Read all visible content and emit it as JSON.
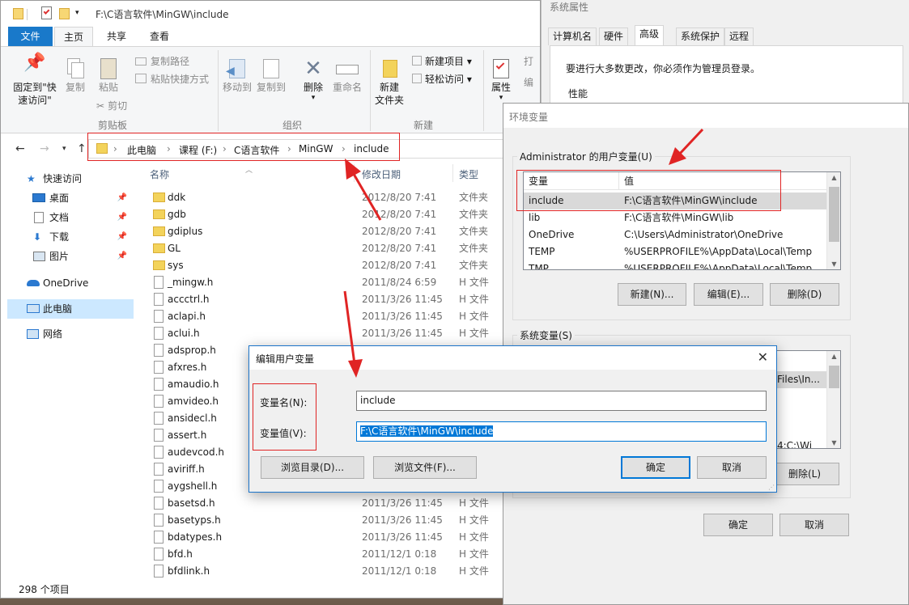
{
  "explorer": {
    "title": "F:\\C语言软件\\MinGW\\include",
    "tabs": [
      "文件",
      "主页",
      "共享",
      "查看"
    ],
    "ribbon": {
      "pin_label": "固定到\"快\n速访问\"",
      "copy_label": "复制",
      "paste_label": "粘贴",
      "copy_path": "复制路径",
      "paste_shortcut": "粘贴快捷方式",
      "cut": "剪切",
      "clipboard_group": "剪贴板",
      "move_to": "移动到",
      "copy_to": "复制到",
      "delete": "删除",
      "rename": "重命名",
      "organize_group": "组织",
      "new_folder": "新建\n文件夹",
      "new_item": "新建项目",
      "easy_access": "轻松访问",
      "new_group": "新建",
      "properties": "属性",
      "open_partial": "打",
      "edit_partial": "编"
    },
    "breadcrumb": [
      "此电脑",
      "课程 (F:)",
      "C语言软件",
      "MinGW",
      "include"
    ],
    "sidebar": [
      {
        "label": "快速访问",
        "icon": "star-icon"
      },
      {
        "label": "桌面",
        "icon": "desktop-icon"
      },
      {
        "label": "文档",
        "icon": "documents-icon"
      },
      {
        "label": "下载",
        "icon": "download-icon"
      },
      {
        "label": "图片",
        "icon": "pictures-icon"
      },
      {
        "label": "OneDrive",
        "icon": "cloud-icon"
      },
      {
        "label": "此电脑",
        "icon": "pc-icon"
      },
      {
        "label": "网络",
        "icon": "network-icon"
      }
    ],
    "columns": {
      "name": "名称",
      "date": "修改日期",
      "type": "类型"
    },
    "files": [
      {
        "name": "ddk",
        "date": "2012/8/20 7:41",
        "type": "文件夹",
        "kind": "folder"
      },
      {
        "name": "gdb",
        "date": "2012/8/20 7:41",
        "type": "文件夹",
        "kind": "folder"
      },
      {
        "name": "gdiplus",
        "date": "2012/8/20 7:41",
        "type": "文件夹",
        "kind": "folder"
      },
      {
        "name": "GL",
        "date": "2012/8/20 7:41",
        "type": "文件夹",
        "kind": "folder"
      },
      {
        "name": "sys",
        "date": "2012/8/20 7:41",
        "type": "文件夹",
        "kind": "folder"
      },
      {
        "name": "_mingw.h",
        "date": "2011/8/24 6:59",
        "type": "H 文件",
        "kind": "file"
      },
      {
        "name": "accctrl.h",
        "date": "2011/3/26 11:45",
        "type": "H 文件",
        "kind": "file"
      },
      {
        "name": "aclapi.h",
        "date": "2011/3/26 11:45",
        "type": "H 文件",
        "kind": "file"
      },
      {
        "name": "aclui.h",
        "date": "2011/3/26 11:45",
        "type": "H 文件",
        "kind": "file"
      },
      {
        "name": "adsprop.h",
        "date": "",
        "type": "",
        "kind": "file"
      },
      {
        "name": "afxres.h",
        "date": "",
        "type": "",
        "kind": "file"
      },
      {
        "name": "amaudio.h",
        "date": "",
        "type": "",
        "kind": "file"
      },
      {
        "name": "amvideo.h",
        "date": "",
        "type": "",
        "kind": "file"
      },
      {
        "name": "ansidecl.h",
        "date": "",
        "type": "",
        "kind": "file"
      },
      {
        "name": "assert.h",
        "date": "",
        "type": "",
        "kind": "file"
      },
      {
        "name": "audevcod.h",
        "date": "",
        "type": "",
        "kind": "file"
      },
      {
        "name": "aviriff.h",
        "date": "",
        "type": "",
        "kind": "file"
      },
      {
        "name": "aygshell.h",
        "date": "",
        "type": "",
        "kind": "file"
      },
      {
        "name": "basetsd.h",
        "date": "2011/3/26 11:45",
        "type": "H 文件",
        "kind": "file"
      },
      {
        "name": "basetyps.h",
        "date": "2011/3/26 11:45",
        "type": "H 文件",
        "kind": "file"
      },
      {
        "name": "bdatypes.h",
        "date": "2011/3/26 11:45",
        "type": "H 文件",
        "kind": "file"
      },
      {
        "name": "bfd.h",
        "date": "2011/12/1 0:18",
        "type": "H 文件",
        "kind": "file"
      },
      {
        "name": "bfdlink.h",
        "date": "2011/12/1 0:18",
        "type": "H 文件",
        "kind": "file"
      }
    ],
    "status": "298 个项目"
  },
  "sysprop": {
    "title": "系统属性",
    "tabs": [
      "计算机名",
      "硬件",
      "高级",
      "系统保护",
      "远程"
    ],
    "admin_note": "要进行大多数更改，你必须作为管理员登录。",
    "perf_label": "性能"
  },
  "envvars": {
    "title": "环境变量",
    "user_group_label": "Administrator 的用户变量(U)",
    "col_var": "变量",
    "col_val": "值",
    "user_vars": [
      {
        "name": "include",
        "value": "F:\\C语言软件\\MinGW\\include"
      },
      {
        "name": "lib",
        "value": "F:\\C语言软件\\MinGW\\lib"
      },
      {
        "name": "OneDrive",
        "value": "C:\\Users\\Administrator\\OneDrive"
      },
      {
        "name": "TEMP",
        "value": "%USERPROFILE%\\AppData\\Local\\Temp"
      },
      {
        "name": "TMP",
        "value": "%USERPROFILE%\\AppData\\Local\\Temp"
      }
    ],
    "new_btn": "新建(N)...",
    "edit_btn": "编辑(E)...",
    "delete_btn": "删除(D)",
    "sys_group_label": "系统变量(S)",
    "sys_partial_1": "Files\\In...",
    "sys_partial_2": "4;C:\\Wi",
    "sys_delete_btn": "删除(L)",
    "ok_btn": "确定",
    "cancel_btn": "取消"
  },
  "editdlg": {
    "title": "编辑用户变量",
    "name_label": "变量名(N):",
    "value_label": "变量值(V):",
    "name_value": "include",
    "value_value": "F:\\C语言软件\\MinGW\\include",
    "browse_dir": "浏览目录(D)...",
    "browse_file": "浏览文件(F)...",
    "ok": "确定",
    "cancel": "取消"
  },
  "colors": {
    "accent": "#0078d7",
    "file_tab": "#1979ca",
    "annotation": "#e02424",
    "selection": "#cce8ff"
  }
}
